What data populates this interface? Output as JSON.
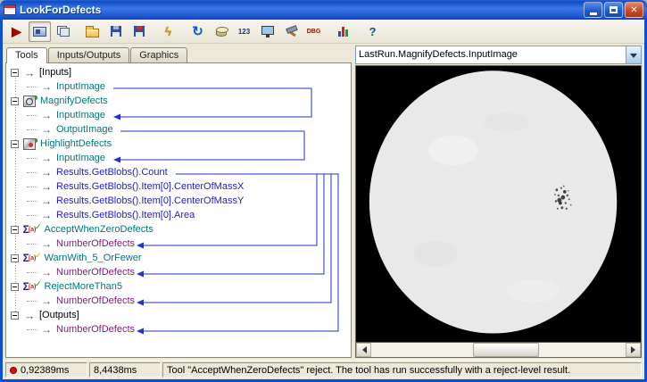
{
  "window": {
    "title": "LookForDefects",
    "close_glyph": "✕"
  },
  "toolbar": {
    "run_glyph": "▶",
    "zap_glyph": "ϟ",
    "refresh_glyph": "↻",
    "numeric_label": "123",
    "debug_label": "DBG",
    "help_glyph": "?"
  },
  "tabs": {
    "tools": "Tools",
    "inputs_outputs": "Inputs/Outputs",
    "graphics": "Graphics"
  },
  "icons": {
    "arrow": "→",
    "sigma": "Σ",
    "sigma_sup": "(a)",
    "check": "✓"
  },
  "tree": {
    "items": [
      {
        "label": "[Inputs]"
      },
      {
        "label": "InputImage"
      },
      {
        "label": "MagnifyDefects"
      },
      {
        "label": "InputImage"
      },
      {
        "label": "OutputImage"
      },
      {
        "label": "HighlightDefects"
      },
      {
        "label": "InputImage"
      },
      {
        "label": "Results.GetBlobs().Count"
      },
      {
        "label": "Results.GetBlobs().Item[0].CenterOfMassX"
      },
      {
        "label": "Results.GetBlobs().Item[0].CenterOfMassY"
      },
      {
        "label": "Results.GetBlobs().Item[0].Area"
      },
      {
        "label": "AcceptWhenZeroDefects"
      },
      {
        "label": "NumberOfDefects"
      },
      {
        "label": "WarnWith_5_OrFewer"
      },
      {
        "label": "NumberOfDefects"
      },
      {
        "label": "RejectMoreThan5"
      },
      {
        "label": "NumberOfDefects"
      },
      {
        "label": "[Outputs]"
      },
      {
        "label": "NumberOfDefects"
      }
    ]
  },
  "viewer": {
    "source_selector": "LastRun.MagnifyDefects.InputImage"
  },
  "status": {
    "time1": "0,92389ms",
    "time2": "8,4438ms",
    "message": "Tool \"AcceptWhenZeroDefects\" reject. The tool has run successfully with a reject-level result."
  },
  "colors": {
    "accent": "#0a50d0",
    "teal": "#007878",
    "purple": "#80207a",
    "link_blue": "#2233cc"
  }
}
